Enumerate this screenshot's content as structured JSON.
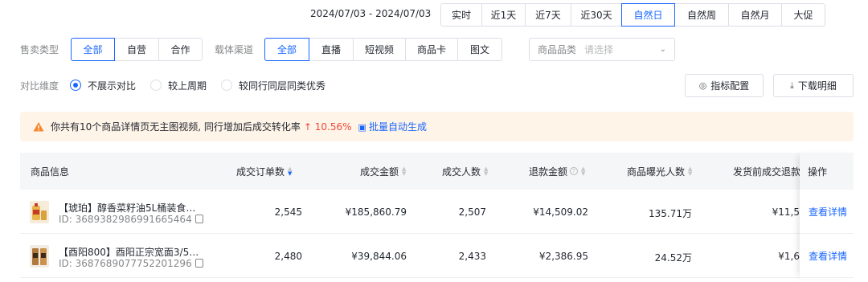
{
  "date_range": "2024/07/03 - 2024/07/03",
  "range_tabs": [
    "实时",
    "近1天",
    "近7天",
    "近30天",
    "自然日",
    "自然周",
    "自然月",
    "大促"
  ],
  "range_active": "自然日",
  "sale_type": {
    "label": "售卖类型",
    "options": [
      "全部",
      "自营",
      "合作"
    ],
    "active": "全部"
  },
  "channel": {
    "label": "载体渠道",
    "options": [
      "全部",
      "直播",
      "短视频",
      "商品卡",
      "图文"
    ],
    "active": "全部"
  },
  "category": {
    "label": "商品品类",
    "placeholder": "请选择"
  },
  "compare": {
    "label": "对比维度",
    "options": [
      "不展示对比",
      "较上周期",
      "较同行同层同类优秀"
    ],
    "active": "不展示对比"
  },
  "tools": {
    "metric_config": "指标配置",
    "download": "下载明细"
  },
  "notice": {
    "text": "你共有10个商品详情页无主图视频, 同行增加后成交转化率",
    "lift": "↑ 10.56%",
    "link": "批量自动生成"
  },
  "table": {
    "headers": {
      "product": "商品信息",
      "orders": "成交订单数",
      "amount": "成交金额",
      "buyers": "成交人数",
      "refund": "退款金额",
      "exposure": "商品曝光人数",
      "pre_ship_refund": "发货前成交退款金",
      "op": "操作"
    },
    "rows": [
      {
        "name": "【琥珀】醇香菜籽油5L桶装食用油...",
        "id": "ID: 3689382986991665464",
        "orders": "2,545",
        "amount": "¥185,860.79",
        "buyers": "2,507",
        "refund": "¥14,509.02",
        "exposure": "135.71万",
        "pre_ship_refund": "¥11,5",
        "op": "查看详情",
        "thumb_color": "#e8b64a"
      },
      {
        "name": "【酉阳800】酉阳正宗宽面3/5斤 ...",
        "id": "ID: 3687689077752201296",
        "orders": "2,480",
        "amount": "¥39,844.06",
        "buyers": "2,433",
        "refund": "¥2,386.95",
        "exposure": "24.52万",
        "pre_ship_refund": "¥1,6",
        "op": "查看详情",
        "thumb_color": "#b07a3e"
      }
    ]
  },
  "colors": {
    "accent": "#1966ff",
    "notice_bg": "#fff4e8",
    "warn": "#f5862c",
    "up": "#f0483a"
  }
}
